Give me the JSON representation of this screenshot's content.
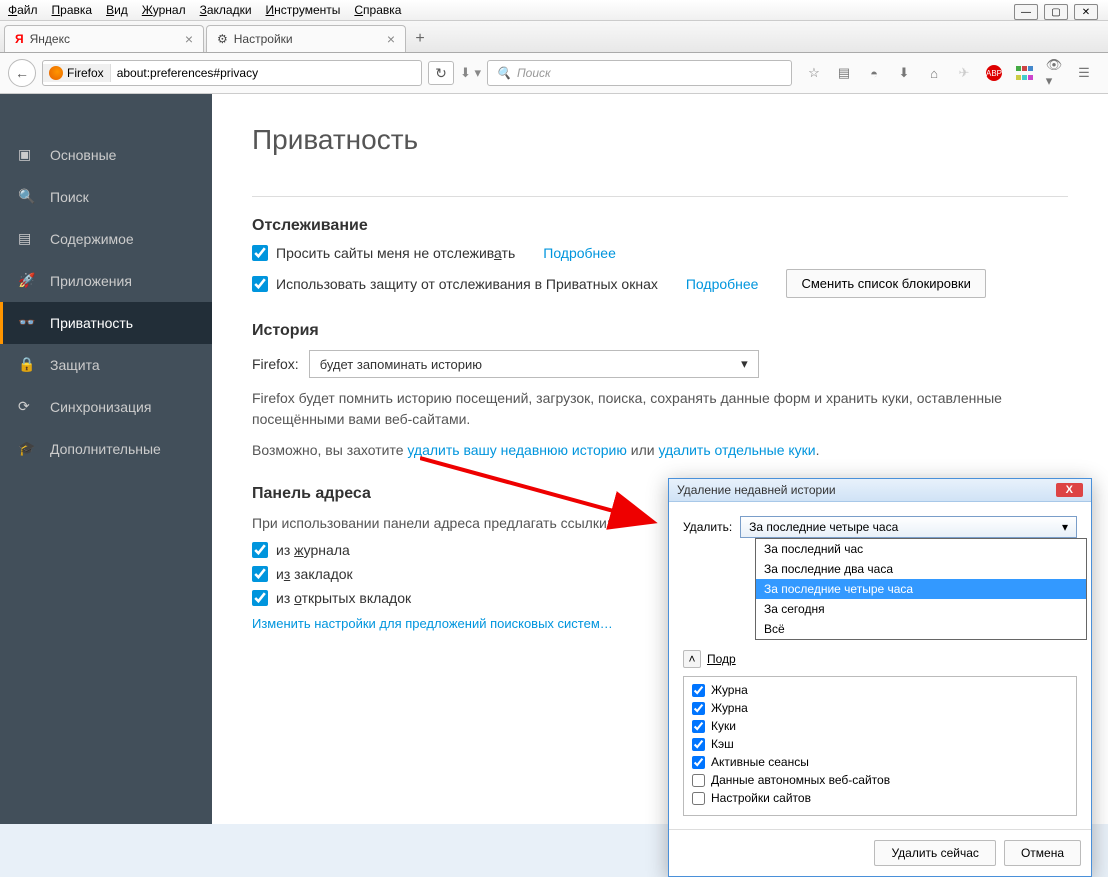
{
  "menu": {
    "items": [
      "Файл",
      "Правка",
      "Вид",
      "Журнал",
      "Закладки",
      "Инструменты",
      "Справка"
    ]
  },
  "tabs": [
    {
      "label": "Яндекс",
      "icon": "yandex"
    },
    {
      "label": "Настройки",
      "icon": "gear"
    }
  ],
  "url": {
    "identity": "Firefox",
    "value": "about:preferences#privacy"
  },
  "search": {
    "placeholder": "Поиск"
  },
  "sidebar": {
    "items": [
      {
        "label": "Основные",
        "icon": "window"
      },
      {
        "label": "Поиск",
        "icon": "search"
      },
      {
        "label": "Содержимое",
        "icon": "doc"
      },
      {
        "label": "Приложения",
        "icon": "rocket"
      },
      {
        "label": "Приватность",
        "icon": "mask",
        "active": true
      },
      {
        "label": "Защита",
        "icon": "lock"
      },
      {
        "label": "Синхронизация",
        "icon": "sync"
      },
      {
        "label": "Дополнительные",
        "icon": "hat"
      }
    ]
  },
  "panel": {
    "title": "Приватность",
    "tracking": {
      "heading": "Отслеживание",
      "do_not_track": "Просить сайты меня не отслеживать",
      "tracking_protection": "Использовать защиту от отслеживания в Приватных окнах",
      "learn_more": "Подробнее",
      "change_blocklist": "Сменить список блокировки"
    },
    "history": {
      "heading": "История",
      "prefix": "Firefox:",
      "mode": "будет запоминать историю",
      "description": "Firefox будет помнить историю посещений, загрузок, поиска, сохранять данные форм и хранить куки, оставленные посещёнными вами веб-сайтами.",
      "maybe": "Возможно, вы захотите ",
      "clear_link": "удалить вашу недавнюю историю",
      "or": " или ",
      "cookies_link": "удалить отдельные куки"
    },
    "addressbar": {
      "heading": "Панель адреса",
      "intro": "При использовании панели адреса предлагать ссылки:",
      "from_journal": "из журнала",
      "from_bookmarks": "из закладок",
      "from_open_tabs": "из открытых вкладок",
      "search_settings": "Изменить настройки для предложений поисковых систем…"
    }
  },
  "dialog": {
    "title": "Удаление недавней истории",
    "delete_label": "Удалить:",
    "selected": "За последние четыре часа",
    "options": [
      "За последний час",
      "За последние два часа",
      "За последние четыре часа",
      "За сегодня",
      "Всё"
    ],
    "details": "Подр",
    "items": [
      {
        "label": "Журна",
        "checked": true
      },
      {
        "label": "Журна",
        "checked": true
      },
      {
        "label": "Куки",
        "checked": true
      },
      {
        "label": "Кэш",
        "checked": true
      },
      {
        "label": "Активные сеансы",
        "checked": true
      },
      {
        "label": "Данные автономных веб-сайтов",
        "checked": false
      },
      {
        "label": "Настройки сайтов",
        "checked": false
      }
    ],
    "ok": "Удалить сейчас",
    "cancel": "Отмена"
  }
}
